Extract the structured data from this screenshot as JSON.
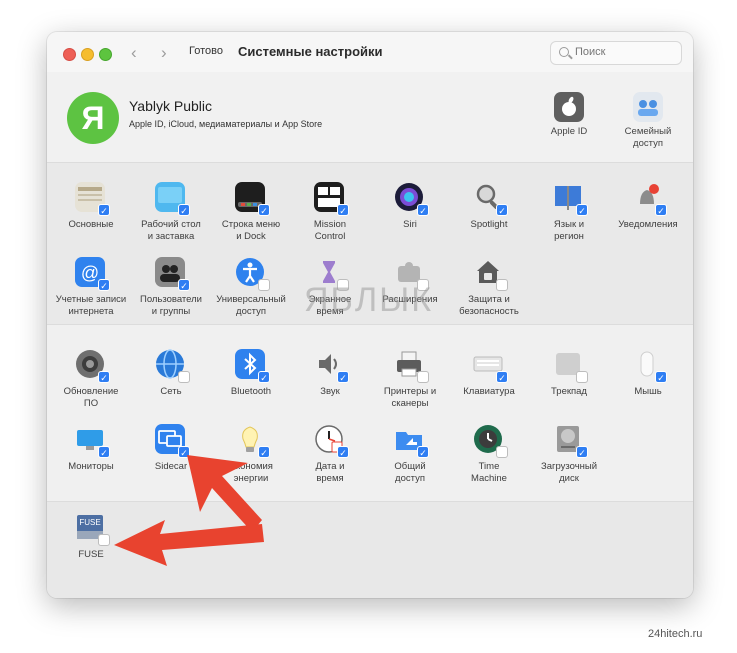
{
  "window": {
    "done_label": "Готово",
    "title": "Системные настройки",
    "search_placeholder": "Поиск"
  },
  "account": {
    "avatar_letter": "Я",
    "name": "Yablyk Public",
    "subtitle": "Apple ID, iCloud, медиаматериалы и App Store",
    "apple_id_label": "Apple ID",
    "family_label": "Семейный\nдоступ"
  },
  "pane_groups": [
    {
      "items": [
        {
          "label": "Основные",
          "icon": "general-icon",
          "checked": true
        },
        {
          "label": "Рабочий стол\nи заставка",
          "icon": "desktop-icon",
          "checked": true
        },
        {
          "label": "Строка меню\nи Dock",
          "icon": "dock-icon",
          "checked": true
        },
        {
          "label": "Mission\nControl",
          "icon": "mission-control-icon",
          "checked": true
        },
        {
          "label": "Siri",
          "icon": "siri-icon",
          "checked": true
        },
        {
          "label": "Spotlight",
          "icon": "spotlight-icon",
          "checked": true
        },
        {
          "label": "Язык и\nрегион",
          "icon": "language-icon",
          "checked": true
        },
        {
          "label": "Уведомления",
          "icon": "notifications-icon",
          "checked": true
        },
        {
          "label": "Учетные записи\nинтернета",
          "icon": "internet-accounts-icon",
          "checked": true
        },
        {
          "label": "Пользователи\nи группы",
          "icon": "users-icon",
          "checked": true
        },
        {
          "label": "Универсальный\nдоступ",
          "icon": "accessibility-icon",
          "checked": false
        },
        {
          "label": "Экранное\nвремя",
          "icon": "screen-time-icon",
          "checked": false
        },
        {
          "label": "Расширения",
          "icon": "extensions-icon",
          "checked": false
        },
        {
          "label": "Защита и\nбезопасность",
          "icon": "security-icon",
          "checked": false
        }
      ]
    },
    {
      "items": [
        {
          "label": "Обновление\nПО",
          "icon": "software-update-icon",
          "checked": true
        },
        {
          "label": "Сеть",
          "icon": "network-icon",
          "checked": false
        },
        {
          "label": "Bluetooth",
          "icon": "bluetooth-icon",
          "checked": true
        },
        {
          "label": "Звук",
          "icon": "sound-icon",
          "checked": true
        },
        {
          "label": "Принтеры и\nсканеры",
          "icon": "printers-icon",
          "checked": false
        },
        {
          "label": "Клавиатура",
          "icon": "keyboard-icon",
          "checked": true
        },
        {
          "label": "Трекпад",
          "icon": "trackpad-icon",
          "checked": false
        },
        {
          "label": "Мышь",
          "icon": "mouse-icon",
          "checked": true
        },
        {
          "label": "Мониторы",
          "icon": "displays-icon",
          "checked": true
        },
        {
          "label": "Sidecar",
          "icon": "sidecar-icon",
          "checked": true
        },
        {
          "label": "Экономия\nэнергии",
          "icon": "energy-saver-icon",
          "checked": true
        },
        {
          "label": "Дата и\nвремя",
          "icon": "date-time-icon",
          "checked": true
        },
        {
          "label": "Общий\nдоступ",
          "icon": "sharing-icon",
          "checked": true
        },
        {
          "label": "Time\nMachine",
          "icon": "time-machine-icon",
          "checked": false
        },
        {
          "label": "Загрузочный\nдиск",
          "icon": "startup-disk-icon",
          "checked": true
        }
      ]
    },
    {
      "items": [
        {
          "label": "FUSE",
          "icon": "fuse-icon",
          "checked": false,
          "badge": "FUSE"
        }
      ]
    }
  ],
  "watermark": "ЯБЛЫК",
  "footer": "24hitech.ru",
  "colors": {
    "check_blue": "#2f7ef3",
    "avatar_green": "#5dc342",
    "arrow_red": "#e8432f"
  }
}
